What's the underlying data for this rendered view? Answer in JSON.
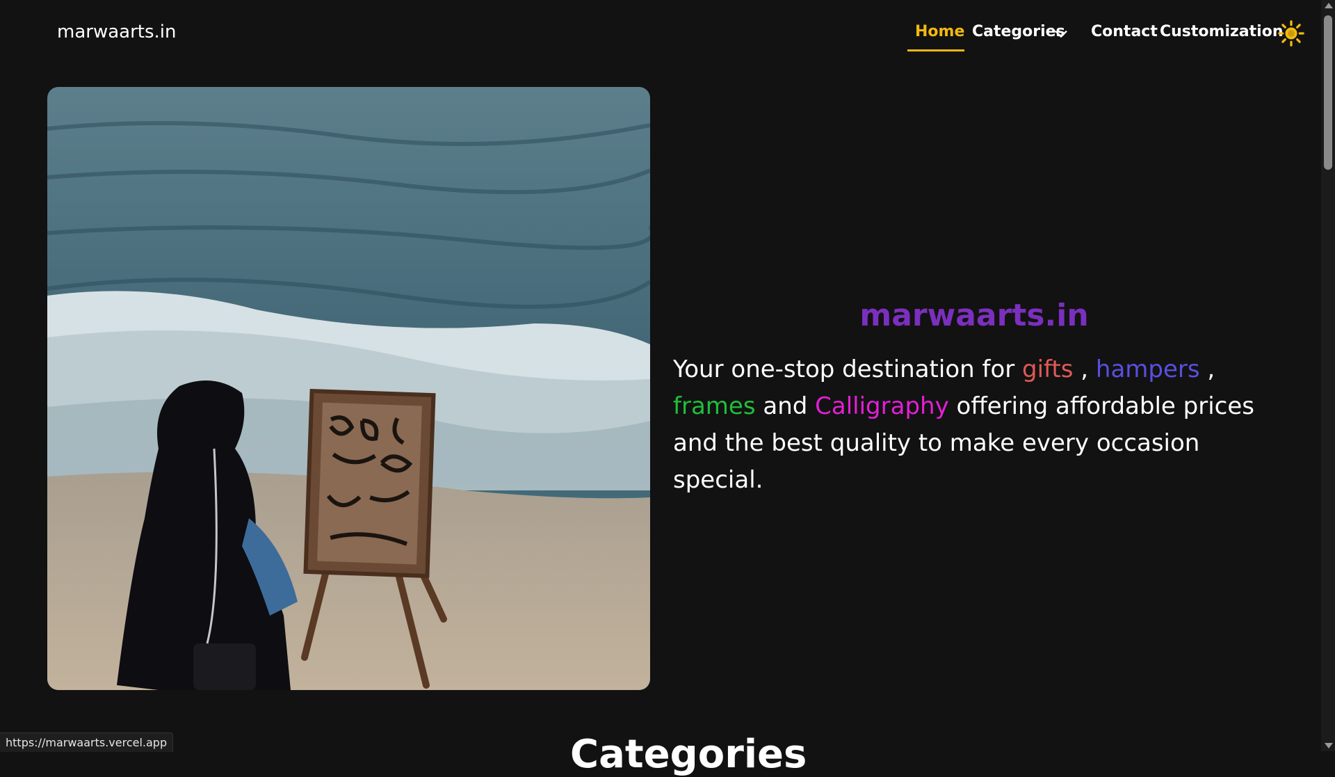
{
  "header": {
    "logo": "marwaarts.in",
    "nav": {
      "home": "Home",
      "categories": "Categories",
      "contact": "Contact",
      "customization": "Customization"
    },
    "theme_toggle_icon": "sun-icon",
    "accent_color": "#f2b90f"
  },
  "hero": {
    "image_icon": "hero-photo",
    "title": "marwaarts.in",
    "tagline": {
      "intro": "Your one-stop destination for ",
      "gifts": "gifts",
      "sep1": " , ",
      "hampers": "hampers",
      "sep2": " , ",
      "frames": "frames",
      "and": " and ",
      "calligraphy": "Calligraphy",
      "outro": " offering affordable prices and the best quality to make every occasion special."
    },
    "colors": {
      "title": "#7b2fbe",
      "gifts": "#e05a56",
      "hampers": "#5a4fe0",
      "frames": "#1fbf3a",
      "calligraphy": "#e41fd8"
    }
  },
  "next_section": {
    "title": "Categories"
  },
  "status_bar": {
    "url": "https://marwaarts.vercel.app"
  }
}
